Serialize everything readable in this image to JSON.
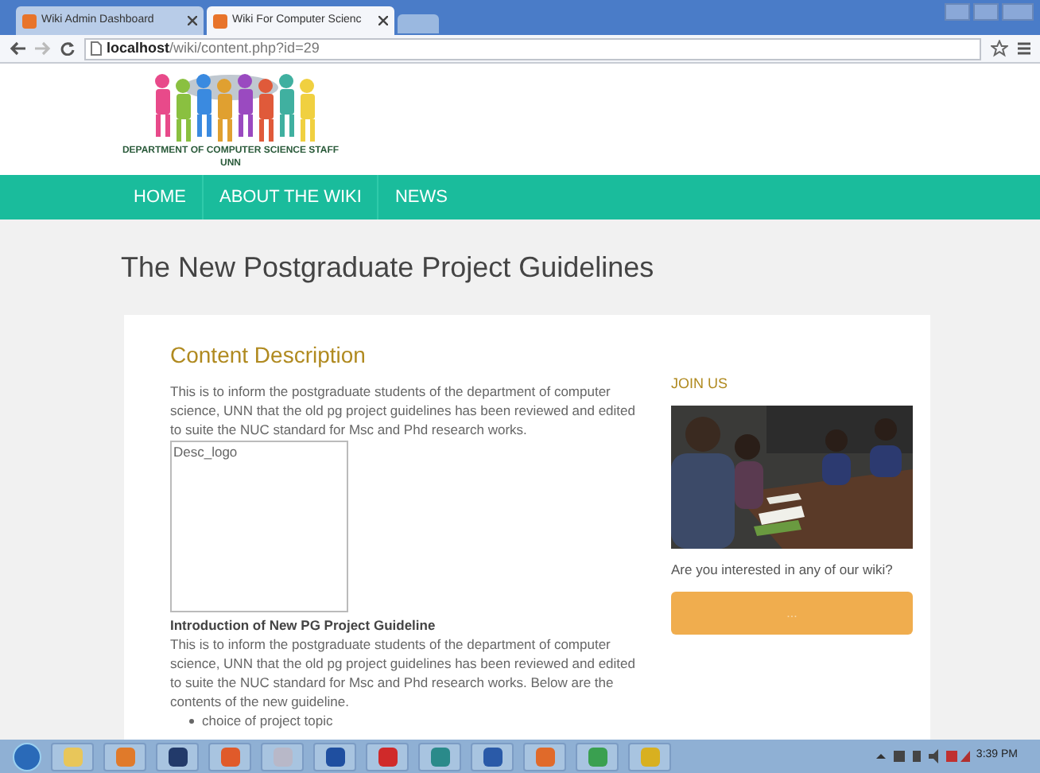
{
  "browser": {
    "tabs": [
      {
        "title": "Wiki Admin Dashboard",
        "selected": false
      },
      {
        "title": "Wiki For Computer Scienc",
        "selected": true
      }
    ],
    "address": "**localhost**/wiki/content.php?id=29"
  },
  "header": {
    "logo_line1": "DEPARTMENT OF COMPUTER SCIENCE STAFF",
    "logo_line2": "UNN"
  },
  "nav": {
    "items": [
      {
        "label": "HOME"
      },
      {
        "label": "ABOUT THE WIKI"
      },
      {
        "label": "NEWS"
      }
    ]
  },
  "page_title": "The New Postgraduate Project Guidelines",
  "content": {
    "heading": "Content Description",
    "description": "This is to inform the postgraduate students of the department of computer science, UNN that the old pg project guidelines has been reviewed and edited to suite the NUC standard for Msc and Phd research works.",
    "image_alt": "Desc_logo",
    "subheading": "Introduction of New PG Project Guideline",
    "body": "This is to inform the postgraduate students of the department of computer science, UNN that the old pg project guidelines has been reviewed and edited to suite the NUC standard for Msc and Phd research works. Below are the contents of the new guideline.",
    "bullets": [
      "choice of project topic"
    ]
  },
  "sidebar": {
    "heading": "JOIN US",
    "question": "Are you interested in any of our wiki?",
    "button_label": "..."
  },
  "taskbar": {
    "clock": "3:39 PM"
  }
}
